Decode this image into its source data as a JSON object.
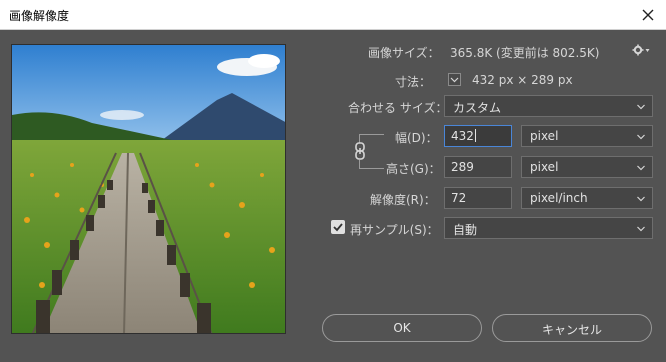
{
  "window": {
    "title": "画像解像度"
  },
  "image_size": {
    "label": "画像サイズ：",
    "value": "365.8K (変更前は 802.5K)"
  },
  "dimensions": {
    "label": "寸法：",
    "value": "432 px × 289 px"
  },
  "fit_to": {
    "label": "合わせる サイズ：",
    "value": "カスタム"
  },
  "width": {
    "label": "幅(D)：",
    "value": "432",
    "unit": "pixel"
  },
  "height": {
    "label": "高さ(G)：",
    "value": "289",
    "unit": "pixel"
  },
  "resolution": {
    "label": "解像度(R)：",
    "value": "72",
    "unit": "pixel/inch"
  },
  "resample": {
    "label": "再サンプル(S)：",
    "value": "自動",
    "checked": true
  },
  "buttons": {
    "ok": "OK",
    "cancel": "キャンセル"
  },
  "colors": {
    "dialog_bg": "#535353",
    "field_bg": "#454545",
    "focus_border": "#4a86d8"
  },
  "icons": {
    "close": "close-icon",
    "settings": "gear-icon",
    "link": "chain-link-icon",
    "dropdown": "chevron-down-icon"
  }
}
